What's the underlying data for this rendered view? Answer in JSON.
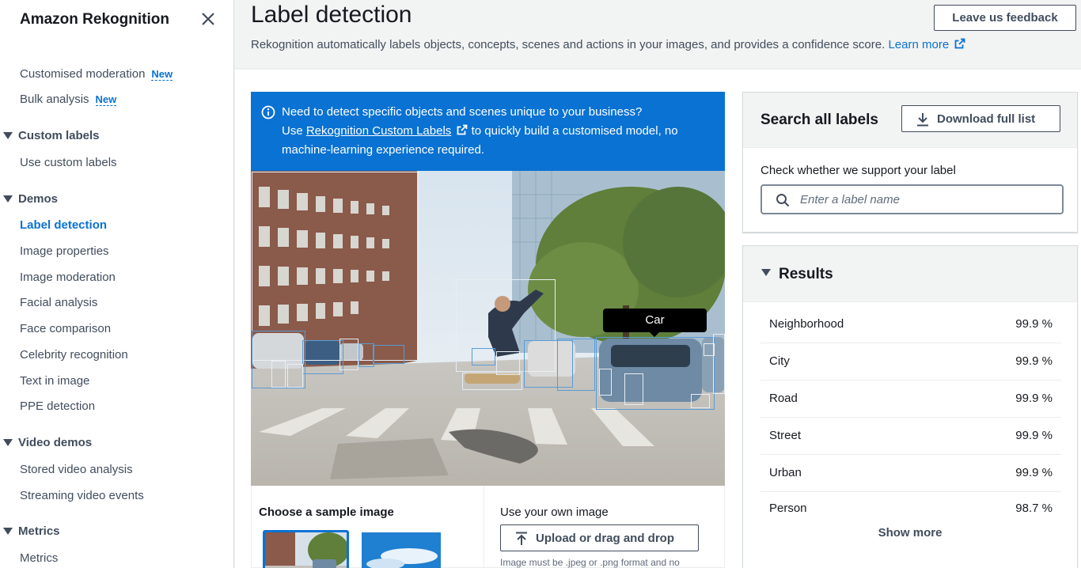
{
  "sidebar": {
    "title": "Amazon Rekognition",
    "top_items": [
      {
        "label": "Customised moderation",
        "badge": "New"
      },
      {
        "label": "Bulk analysis",
        "badge": "New"
      }
    ],
    "sections": [
      {
        "title": "Custom labels",
        "items": [
          "Use custom labels"
        ]
      },
      {
        "title": "Demos",
        "items": [
          "Label detection",
          "Image properties",
          "Image moderation",
          "Facial analysis",
          "Face comparison",
          "Celebrity recognition",
          "Text in image",
          "PPE detection"
        ]
      },
      {
        "title": "Video demos",
        "items": [
          "Stored video analysis",
          "Streaming video events"
        ]
      },
      {
        "title": "Metrics",
        "items": [
          "Metrics"
        ]
      }
    ],
    "active_item": "Label detection"
  },
  "header": {
    "title": "Label detection",
    "description": "Rekognition automatically labels objects, concepts, scenes and actions in your images, and provides a confidence score.",
    "learn_more": "Learn more",
    "feedback_button": "Leave us feedback"
  },
  "banner": {
    "line1": "Need to detect specific objects and scenes unique to your business?",
    "line2_pre": "Use ",
    "line2_link": "Rekognition Custom Labels",
    "line2_post": " to quickly build a customised model, no",
    "line3": "machine-learning experience required."
  },
  "image": {
    "tooltip": "Car"
  },
  "samples": {
    "choose_label": "Choose a sample image",
    "own_label": "Use your own image",
    "upload_button": "Upload or drag and drop",
    "upload_hint": "Image must be .jpeg or .png format and no"
  },
  "search": {
    "title": "Search all labels",
    "download_button": "Download full list",
    "check_label": "Check whether we support your label",
    "placeholder": "Enter a label name"
  },
  "results": {
    "title": "Results",
    "rows": [
      {
        "name": "Neighborhood",
        "confidence": "99.9 %"
      },
      {
        "name": "City",
        "confidence": "99.9 %"
      },
      {
        "name": "Road",
        "confidence": "99.9 %"
      },
      {
        "name": "Street",
        "confidence": "99.9 %"
      },
      {
        "name": "Urban",
        "confidence": "99.9 %"
      },
      {
        "name": "Person",
        "confidence": "98.7 %"
      }
    ],
    "show_more": "Show more"
  },
  "colors": {
    "accent": "#0972d3",
    "text": "#16191f",
    "muted": "#414d5c"
  }
}
